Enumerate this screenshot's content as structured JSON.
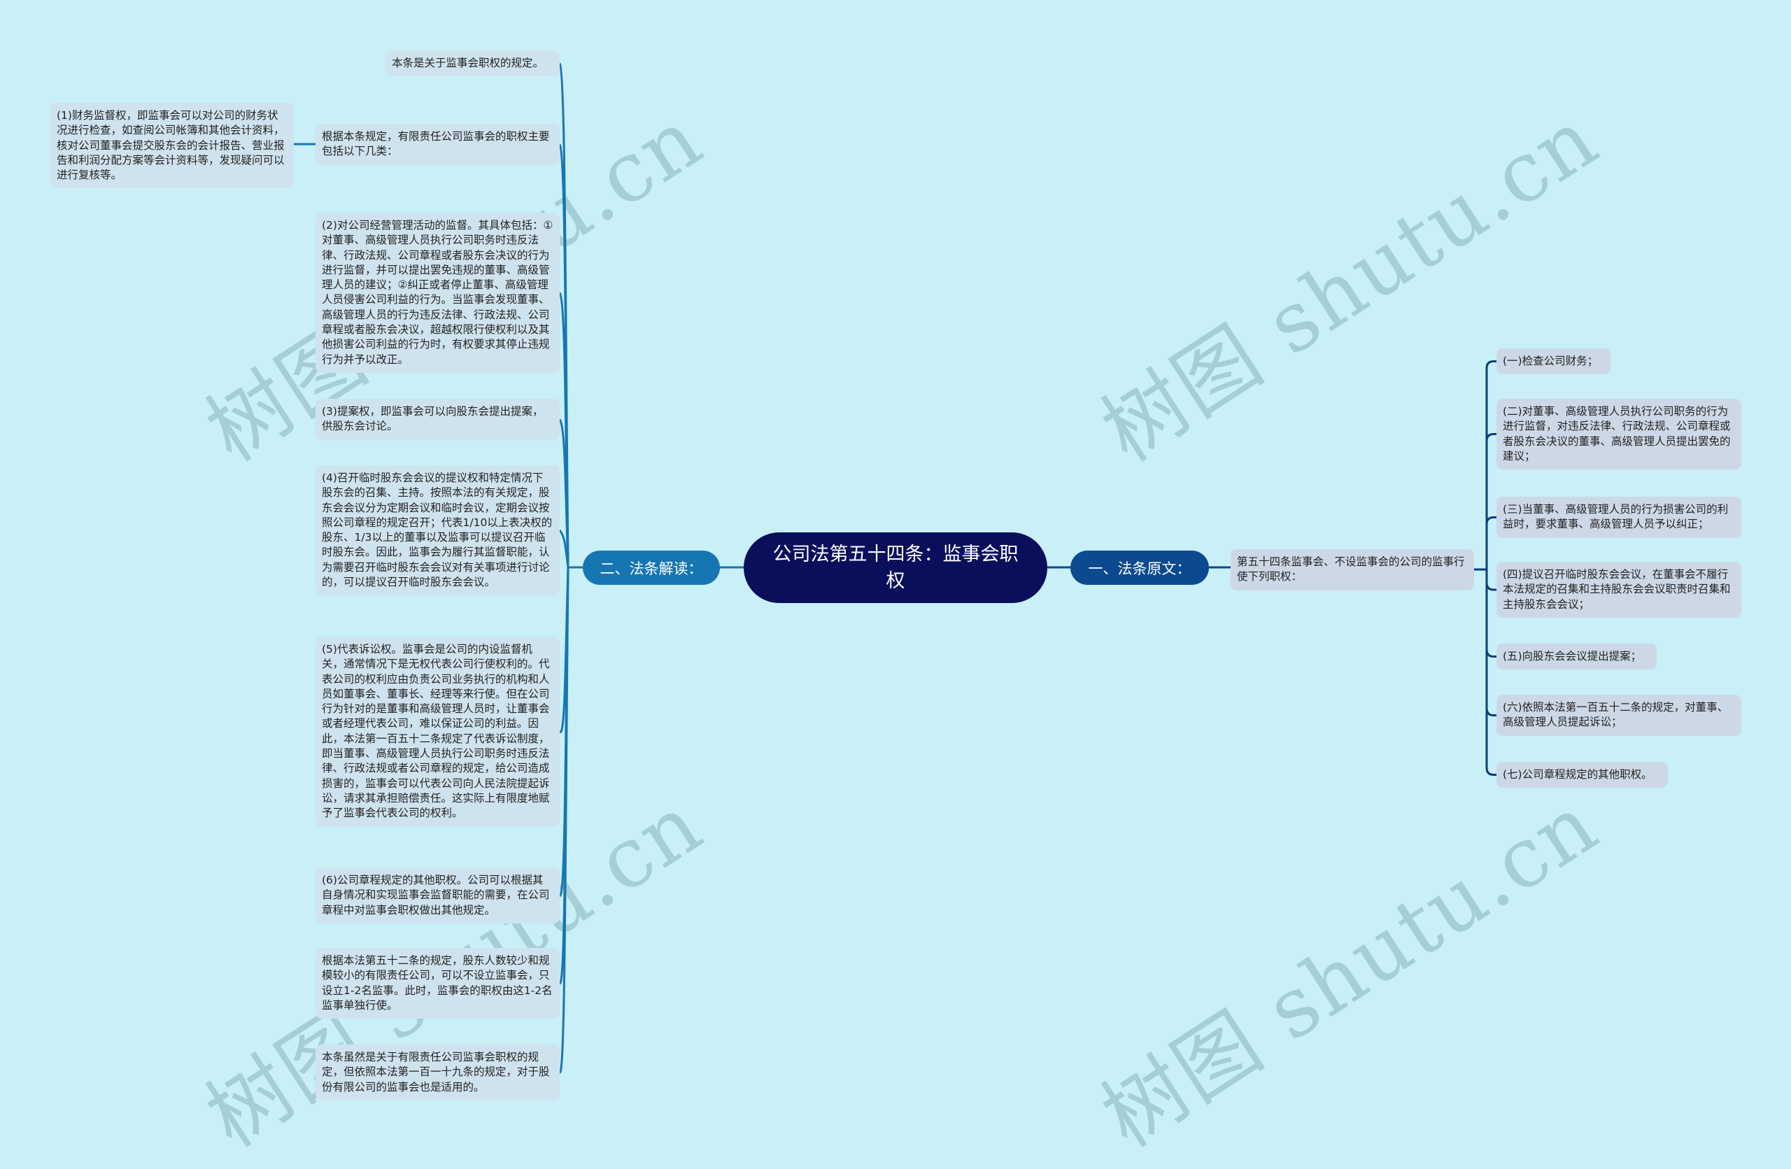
{
  "root": {
    "title": "公司法第五十四条：监事会职权"
  },
  "branches": {
    "left": {
      "label": "二、法条解读："
    },
    "right": {
      "label": "一、法条原文："
    }
  },
  "law_text": "第五十四条监事会、不设监事会的公司的监事行使下列职权：",
  "law_items": [
    "(一)检查公司财务；",
    "(二)对董事、高级管理人员执行公司职务的行为进行监督，对违反法律、行政法规、公司章程或者股东会决议的董事、高级管理人员提出罢免的建议；",
    "(三)当董事、高级管理人员的行为损害公司的利益时，要求董事、高级管理人员予以纠正；",
    "(四)提议召开临时股东会会议，在董事会不履行本法规定的召集和主持股东会会议职责时召集和主持股东会会议；",
    "(五)向股东会会议提出提案；",
    "(六)依照本法第一百五十二条的规定，对董事、高级管理人员提起诉讼；",
    "(七)公司章程规定的其他职权。"
  ],
  "interpretation_items": [
    "本条是关于监事会职权的规定。",
    "根据本条规定，有限责任公司监事会的职权主要包括以下几类：",
    "(2)对公司经营管理活动的监督。其具体包括：①对董事、高级管理人员执行公司职务时违反法律、行政法规、公司章程或者股东会决议的行为进行监督，并可以提出罢免违规的董事、高级管理人员的建议；②纠正或者停止董事、高级管理人员侵害公司利益的行为。当监事会发现董事、高级管理人员的行为违反法律、行政法规、公司章程或者股东会决议，超越权限行使权利以及其他损害公司利益的行为时，有权要求其停止违规行为并予以改正。",
    "(3)提案权，即监事会可以向股东会提出提案，供股东会讨论。",
    "(4)召开临时股东会会议的提议权和特定情况下股东会的召集、主持。按照本法的有关规定，股东会会议分为定期会议和临时会议，定期会议按照公司章程的规定召开；代表1/10以上表决权的股东、1/3以上的董事以及监事可以提议召开临时股东会。因此，监事会为履行其监督职能，认为需要召开临时股东会会议对有关事项进行讨论的，可以提议召开临时股东会会议。",
    "(5)代表诉讼权。监事会是公司的内设监督机关，通常情况下是无权代表公司行使权利的。代表公司的权利应由负责公司业务执行的机构和人员如董事会、董事长、经理等来行使。但在公司行为针对的是董事和高级管理人员时，让董事会或者经理代表公司，难以保证公司的利益。因此，本法第一百五十二条规定了代表诉讼制度，即当董事、高级管理人员执行公司职务时违反法律、行政法规或者公司章程的规定，给公司造成损害的，监事会可以代表公司向人民法院提起诉讼，请求其承担赔偿责任。这实际上有限度地赋予了监事会代表公司的权利。",
    "(6)公司章程规定的其他职权。公司可以根据其自身情况和实现监事会监督职能的需要，在公司章程中对监事会职权做出其他规定。",
    "根据本法第五十二条的规定，股东人数较少和规模较小的有限责任公司，可以不设立监事会，只设立1-2名监事。此时，监事会的职权由这1-2名监事单独行使。",
    "本条虽然是关于有限责任公司监事会职权的规定，但依照本法第一百一十九条的规定，对于股份有限公司的监事会也是适用的。"
  ],
  "sub_item": "(1)财务监督权，即监事会可以对公司的财务状况进行检查，如查阅公司帐簿和其他会计资料，核对公司董事会提交股东会的会计报告、营业报告和利润分配方案等会计资料等，发现疑问可以进行复核等。",
  "watermark": "树图 shutu.cn",
  "colors": {
    "background": "#c9eff7",
    "root": "#0a0f5c",
    "branch_left": "#1676b2",
    "branch_right": "#0b4a8e",
    "node_left": "#cfe3ee",
    "node_right": "#cdd8e6"
  }
}
